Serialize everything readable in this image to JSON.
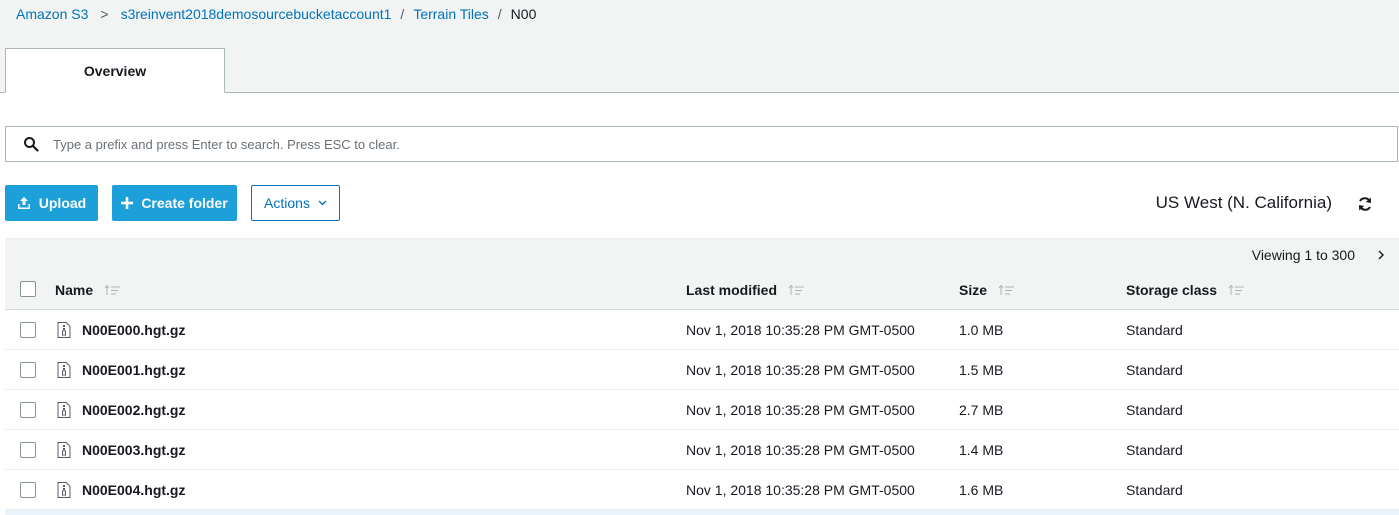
{
  "breadcrumb": {
    "root": "Amazon S3",
    "bucket": "s3reinvent2018demosourcebucketaccount1",
    "folder": "Terrain Tiles",
    "current": "N00",
    "sep_chevron": ">",
    "sep_slash": "/"
  },
  "tabs": [
    {
      "label": "Overview"
    }
  ],
  "search": {
    "placeholder": "Type a prefix and press Enter to search. Press ESC to clear.",
    "value": ""
  },
  "toolbar": {
    "upload_label": "Upload",
    "create_folder_label": "Create folder",
    "actions_label": "Actions",
    "region": "US West (N. California)"
  },
  "pagination": {
    "label": "Viewing 1 to 300"
  },
  "table": {
    "columns": {
      "name": "Name",
      "last_modified": "Last modified",
      "size": "Size",
      "storage_class": "Storage class"
    },
    "rows": [
      {
        "name": "N00E000.hgt.gz",
        "last_modified": "Nov 1, 2018 10:35:28 PM GMT-0500",
        "size": "1.0 MB",
        "storage_class": "Standard"
      },
      {
        "name": "N00E001.hgt.gz",
        "last_modified": "Nov 1, 2018 10:35:28 PM GMT-0500",
        "size": "1.5 MB",
        "storage_class": "Standard"
      },
      {
        "name": "N00E002.hgt.gz",
        "last_modified": "Nov 1, 2018 10:35:28 PM GMT-0500",
        "size": "2.7 MB",
        "storage_class": "Standard"
      },
      {
        "name": "N00E003.hgt.gz",
        "last_modified": "Nov 1, 2018 10:35:28 PM GMT-0500",
        "size": "1.4 MB",
        "storage_class": "Standard"
      },
      {
        "name": "N00E004.hgt.gz",
        "last_modified": "Nov 1, 2018 10:35:28 PM GMT-0500",
        "size": "1.6 MB",
        "storage_class": "Standard"
      }
    ]
  },
  "icons": {
    "search": "search-icon",
    "upload": "upload-icon",
    "plus": "plus-icon",
    "chevron": "chevron-down-icon",
    "refresh": "refresh-icon",
    "next": "chevron-right-icon",
    "sort": "sort-icon",
    "file": "file-archive-icon"
  },
  "colors": {
    "link": "#0073bb",
    "primary_button": "#1d9fd9",
    "header_bg": "#f2f3f3",
    "border": "#aab7b8"
  }
}
